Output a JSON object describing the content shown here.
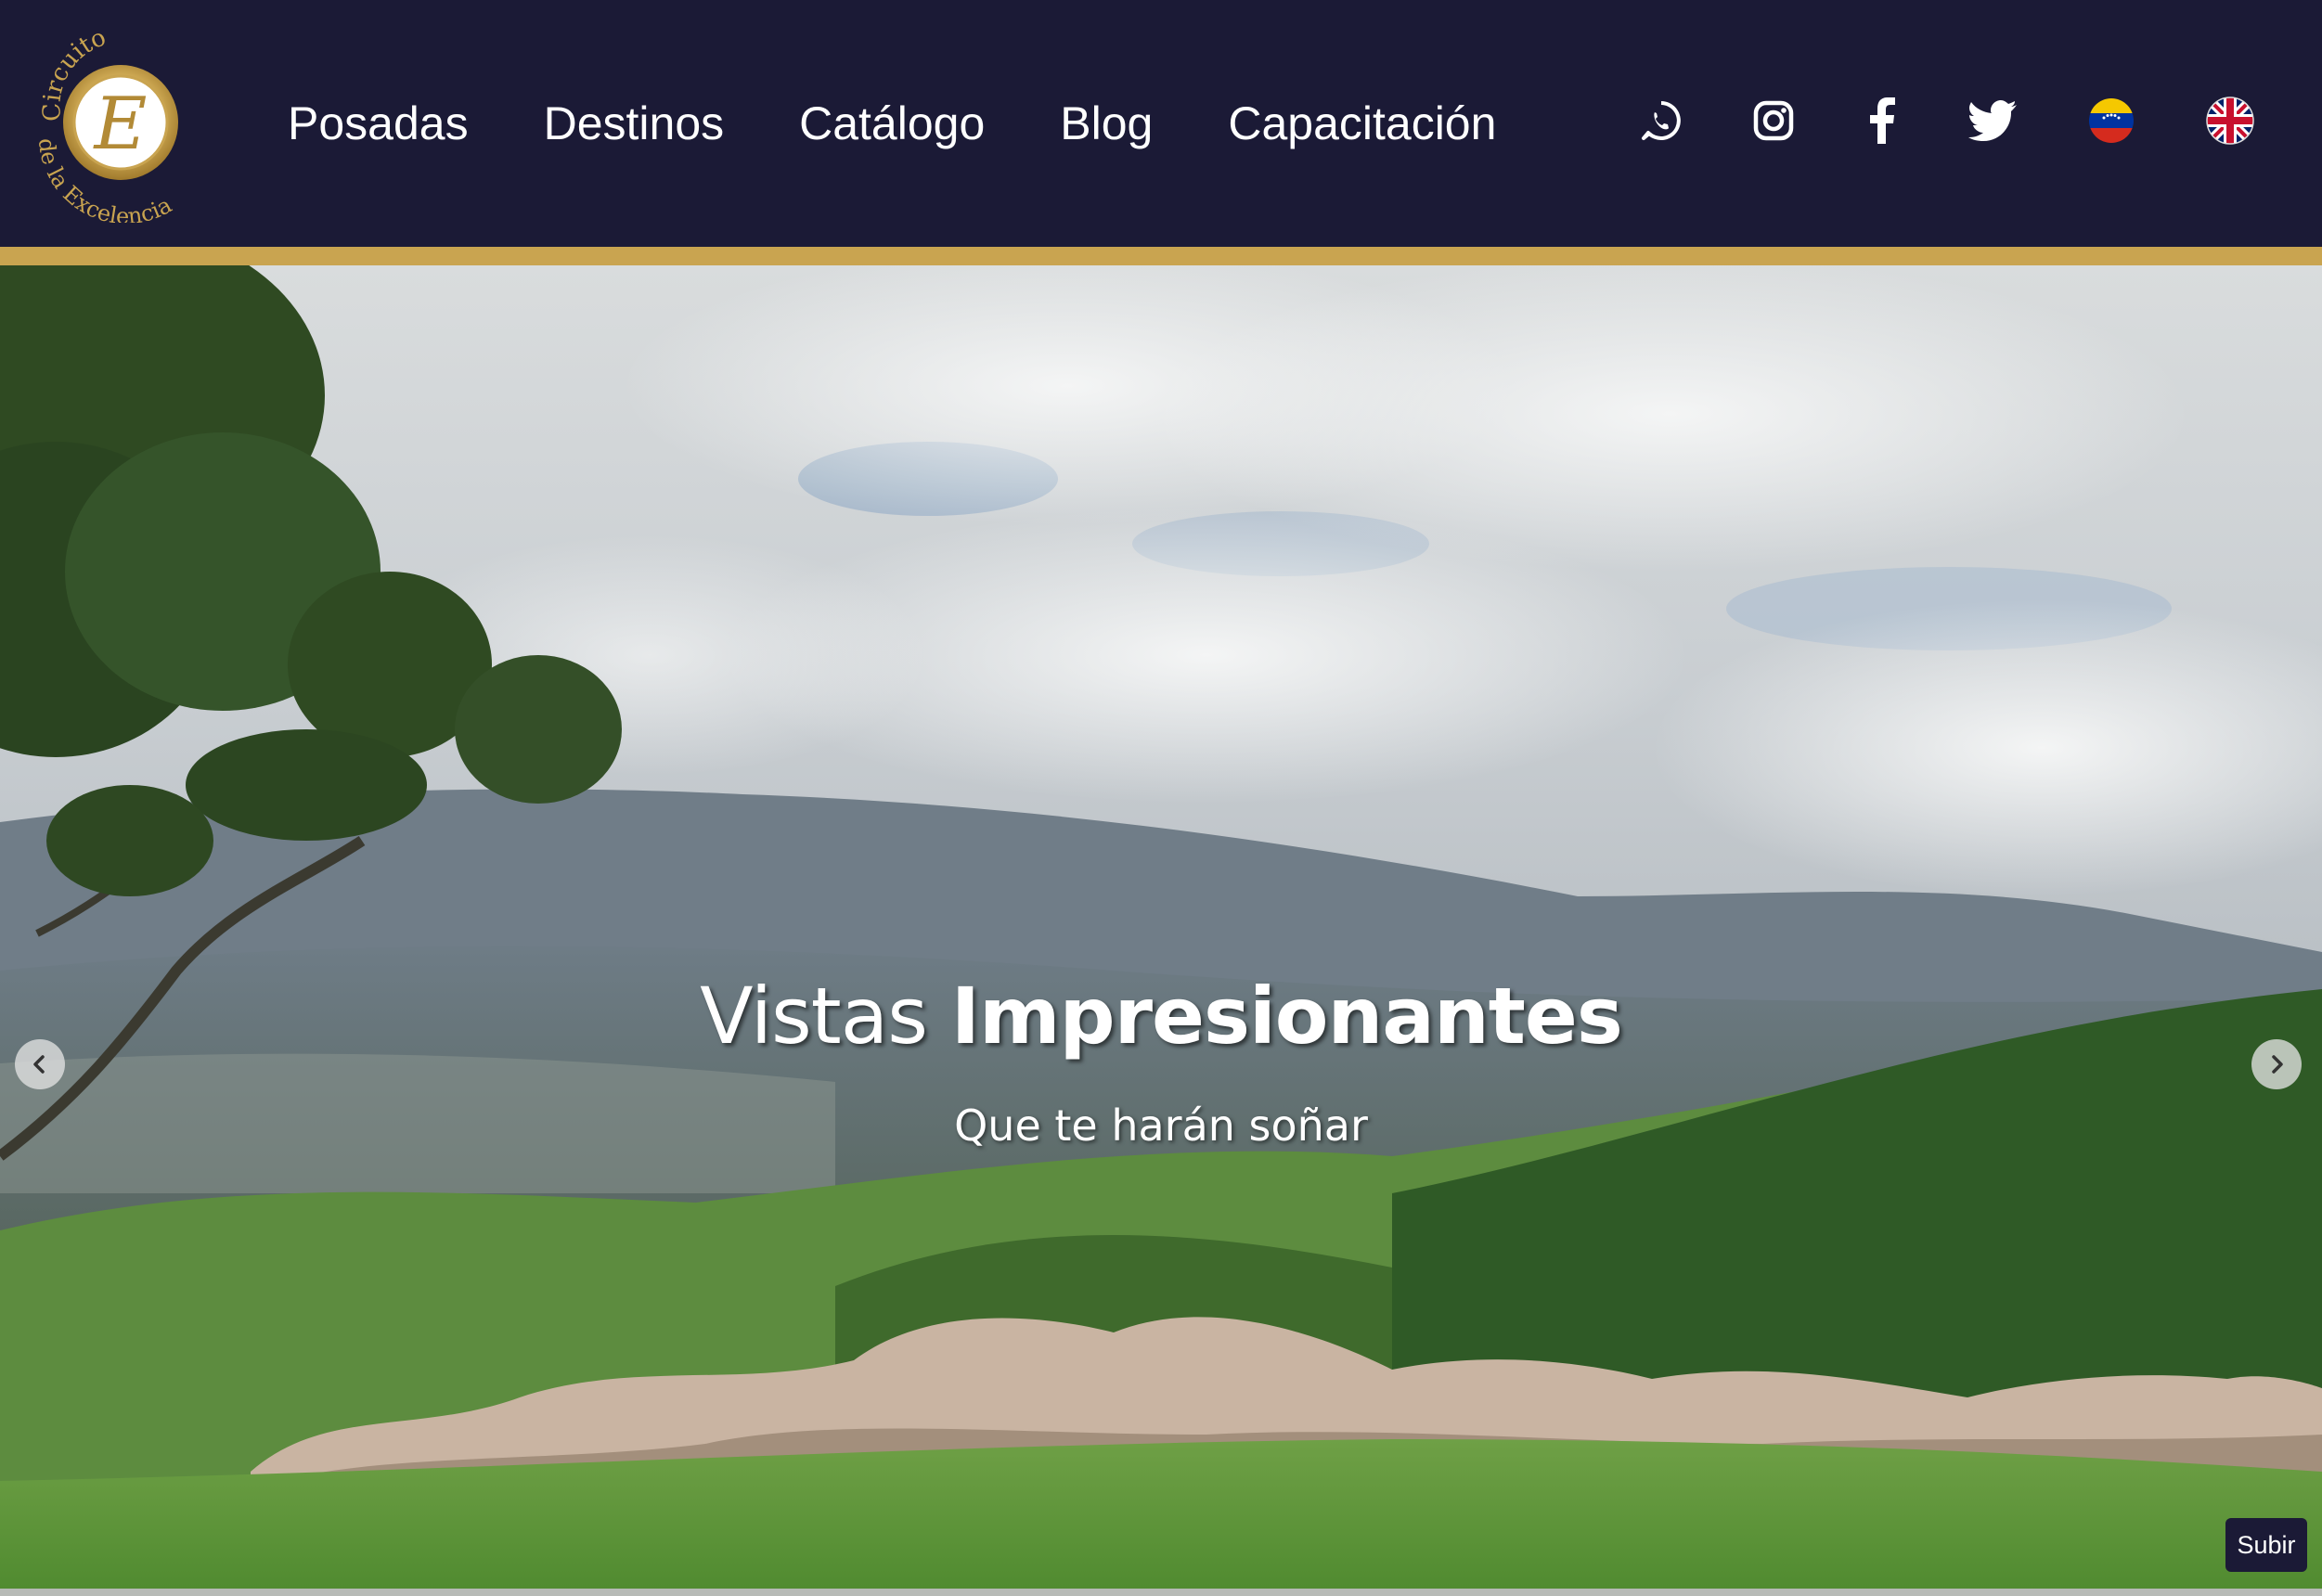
{
  "header": {
    "logo": {
      "top_text": "Circuito",
      "bottom_text": "de la Excelencia",
      "monogram": "E"
    },
    "nav": [
      {
        "label": "Posadas"
      },
      {
        "label": "Destinos"
      },
      {
        "label": "Catálogo"
      },
      {
        "label": "Blog"
      },
      {
        "label": "Capacitación"
      }
    ],
    "social_icons": [
      "whatsapp-icon",
      "instagram-icon",
      "facebook-icon",
      "twitter-icon"
    ],
    "languages": [
      "venezuela-flag-icon",
      "uk-flag-icon"
    ]
  },
  "hero": {
    "title_light": "Vistas",
    "title_bold": "Impresionantes",
    "subtitle": "Que te harán soñar",
    "prev_icon": "chevron-left-icon",
    "next_icon": "chevron-right-icon"
  },
  "scroll_top": {
    "label": "Subir"
  },
  "colors": {
    "header_bg": "#1b1a36",
    "accent_gold": "#c9a450",
    "nav_text": "#ffffff"
  }
}
